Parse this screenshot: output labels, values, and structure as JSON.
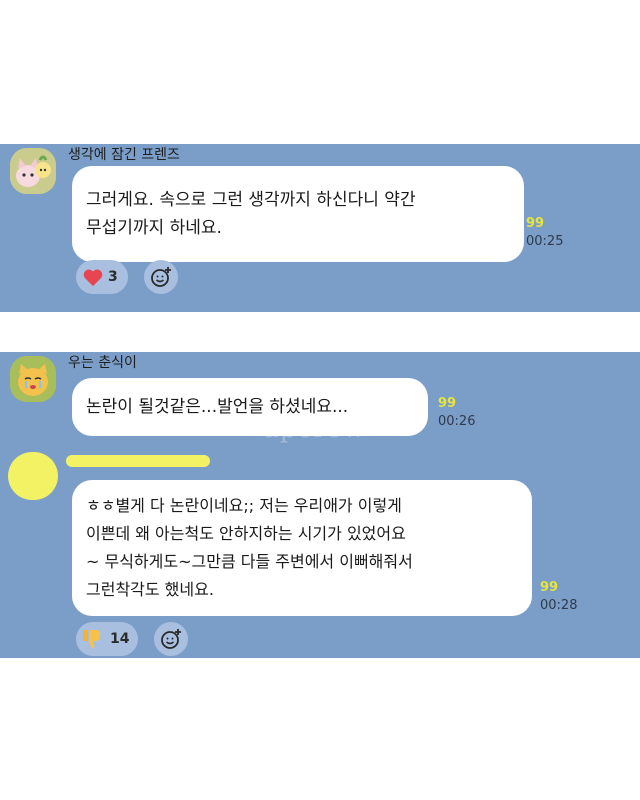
{
  "chat1": {
    "sender": "생각에 잠긴 프렌즈",
    "message_lines": [
      "그러게요. 속으로 그런 생각까지 하신다니 약간",
      "무섭기까지 하네요."
    ],
    "unread": "99",
    "time": "00:25",
    "reaction": {
      "icon": "heart-icon",
      "count": "3"
    }
  },
  "chat2": {
    "sender": "우는 춘식이",
    "message1_lines": [
      "논란이 될것같은...발언을 하셨네요..."
    ],
    "message1_unread": "99",
    "message1_time": "00:26",
    "message2_lines": [
      "ㅎㅎ별게 다 논란이네요;; 저는 우리애가 이렇게",
      "이쁜데 왜 아는척도 안하지하는 시기가 있었어요",
      "~ 무식하게도~그만큼 다들 주변에서 이뻐해줘서",
      "그런착각도 했네요."
    ],
    "message2_unread": "99",
    "message2_time": "00:28",
    "reaction": {
      "icon": "thumbs-down-icon",
      "count": "14"
    }
  },
  "watermark": "upcrew",
  "colors": {
    "chat_bg": "#7b9ec9",
    "bubble": "#ffffff",
    "unread": "#e8e53a",
    "highlight": "#f3f264"
  }
}
